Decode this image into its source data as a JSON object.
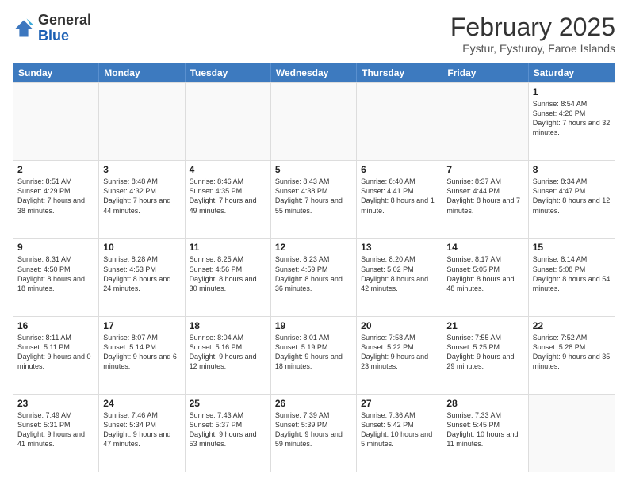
{
  "header": {
    "logo_general": "General",
    "logo_blue": "Blue",
    "month_title": "February 2025",
    "subtitle": "Eystur, Eysturoy, Faroe Islands"
  },
  "days_of_week": [
    "Sunday",
    "Monday",
    "Tuesday",
    "Wednesday",
    "Thursday",
    "Friday",
    "Saturday"
  ],
  "weeks": [
    [
      {
        "day": "",
        "content": ""
      },
      {
        "day": "",
        "content": ""
      },
      {
        "day": "",
        "content": ""
      },
      {
        "day": "",
        "content": ""
      },
      {
        "day": "",
        "content": ""
      },
      {
        "day": "",
        "content": ""
      },
      {
        "day": "1",
        "content": "Sunrise: 8:54 AM\nSunset: 4:26 PM\nDaylight: 7 hours and 32 minutes."
      }
    ],
    [
      {
        "day": "2",
        "content": "Sunrise: 8:51 AM\nSunset: 4:29 PM\nDaylight: 7 hours and 38 minutes."
      },
      {
        "day": "3",
        "content": "Sunrise: 8:48 AM\nSunset: 4:32 PM\nDaylight: 7 hours and 44 minutes."
      },
      {
        "day": "4",
        "content": "Sunrise: 8:46 AM\nSunset: 4:35 PM\nDaylight: 7 hours and 49 minutes."
      },
      {
        "day": "5",
        "content": "Sunrise: 8:43 AM\nSunset: 4:38 PM\nDaylight: 7 hours and 55 minutes."
      },
      {
        "day": "6",
        "content": "Sunrise: 8:40 AM\nSunset: 4:41 PM\nDaylight: 8 hours and 1 minute."
      },
      {
        "day": "7",
        "content": "Sunrise: 8:37 AM\nSunset: 4:44 PM\nDaylight: 8 hours and 7 minutes."
      },
      {
        "day": "8",
        "content": "Sunrise: 8:34 AM\nSunset: 4:47 PM\nDaylight: 8 hours and 12 minutes."
      }
    ],
    [
      {
        "day": "9",
        "content": "Sunrise: 8:31 AM\nSunset: 4:50 PM\nDaylight: 8 hours and 18 minutes."
      },
      {
        "day": "10",
        "content": "Sunrise: 8:28 AM\nSunset: 4:53 PM\nDaylight: 8 hours and 24 minutes."
      },
      {
        "day": "11",
        "content": "Sunrise: 8:25 AM\nSunset: 4:56 PM\nDaylight: 8 hours and 30 minutes."
      },
      {
        "day": "12",
        "content": "Sunrise: 8:23 AM\nSunset: 4:59 PM\nDaylight: 8 hours and 36 minutes."
      },
      {
        "day": "13",
        "content": "Sunrise: 8:20 AM\nSunset: 5:02 PM\nDaylight: 8 hours and 42 minutes."
      },
      {
        "day": "14",
        "content": "Sunrise: 8:17 AM\nSunset: 5:05 PM\nDaylight: 8 hours and 48 minutes."
      },
      {
        "day": "15",
        "content": "Sunrise: 8:14 AM\nSunset: 5:08 PM\nDaylight: 8 hours and 54 minutes."
      }
    ],
    [
      {
        "day": "16",
        "content": "Sunrise: 8:11 AM\nSunset: 5:11 PM\nDaylight: 9 hours and 0 minutes."
      },
      {
        "day": "17",
        "content": "Sunrise: 8:07 AM\nSunset: 5:14 PM\nDaylight: 9 hours and 6 minutes."
      },
      {
        "day": "18",
        "content": "Sunrise: 8:04 AM\nSunset: 5:16 PM\nDaylight: 9 hours and 12 minutes."
      },
      {
        "day": "19",
        "content": "Sunrise: 8:01 AM\nSunset: 5:19 PM\nDaylight: 9 hours and 18 minutes."
      },
      {
        "day": "20",
        "content": "Sunrise: 7:58 AM\nSunset: 5:22 PM\nDaylight: 9 hours and 23 minutes."
      },
      {
        "day": "21",
        "content": "Sunrise: 7:55 AM\nSunset: 5:25 PM\nDaylight: 9 hours and 29 minutes."
      },
      {
        "day": "22",
        "content": "Sunrise: 7:52 AM\nSunset: 5:28 PM\nDaylight: 9 hours and 35 minutes."
      }
    ],
    [
      {
        "day": "23",
        "content": "Sunrise: 7:49 AM\nSunset: 5:31 PM\nDaylight: 9 hours and 41 minutes."
      },
      {
        "day": "24",
        "content": "Sunrise: 7:46 AM\nSunset: 5:34 PM\nDaylight: 9 hours and 47 minutes."
      },
      {
        "day": "25",
        "content": "Sunrise: 7:43 AM\nSunset: 5:37 PM\nDaylight: 9 hours and 53 minutes."
      },
      {
        "day": "26",
        "content": "Sunrise: 7:39 AM\nSunset: 5:39 PM\nDaylight: 9 hours and 59 minutes."
      },
      {
        "day": "27",
        "content": "Sunrise: 7:36 AM\nSunset: 5:42 PM\nDaylight: 10 hours and 5 minutes."
      },
      {
        "day": "28",
        "content": "Sunrise: 7:33 AM\nSunset: 5:45 PM\nDaylight: 10 hours and 11 minutes."
      },
      {
        "day": "",
        "content": ""
      }
    ]
  ]
}
